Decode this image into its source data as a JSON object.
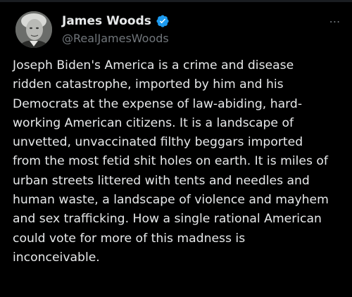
{
  "post": {
    "author": {
      "display_name": "James Woods",
      "handle": "@RealJamesWoods",
      "verified": true,
      "verified_icon": "verified-badge-icon",
      "avatar_icon": "profile-photo"
    },
    "more_icon": "more-options-icon",
    "body_lines": [
      "Joseph Biden's America is a crime and disease",
      "ridden catastrophe, imported by him and his",
      "Democrats at the expense of law-abiding, hard-",
      "working American citizens. It is a landscape of",
      "unvetted, unvaccinated filthy beggars imported",
      "from the most fetid shit holes on earth. It is miles of",
      "urban streets littered with tents and needles and",
      "human waste, a landscape of violence and mayhem",
      "and sex trafficking. How a single rational American",
      "could vote for more of this madness is",
      "inconceivable."
    ]
  },
  "colors": {
    "background": "#000000",
    "primary_text": "#e7e9ea",
    "secondary_text": "#71767b",
    "verified_blue": "#1d9bf0"
  }
}
